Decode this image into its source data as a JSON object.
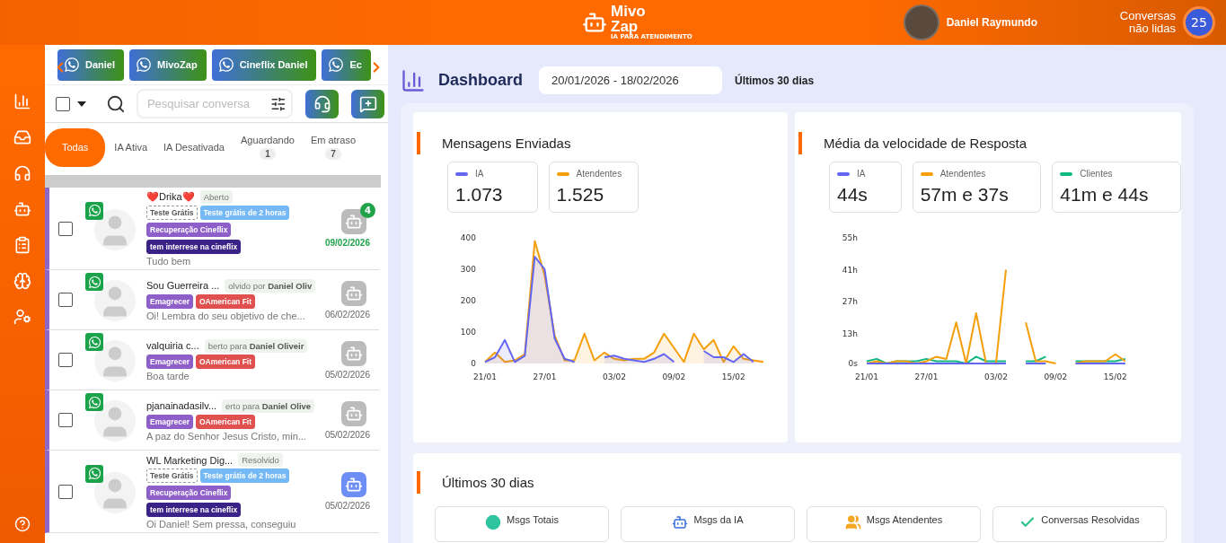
{
  "header": {
    "logo_name": "Mivo",
    "logo_name_2": "Zap",
    "logo_tagline": "IA PARA ATENDIMENTO",
    "user_name": "Daniel Raymundo",
    "unread_label": "Conversas não lidas",
    "unread_count": "25"
  },
  "accounts": [
    {
      "name": "Daniel"
    },
    {
      "name": "MivoZap"
    },
    {
      "name": "Cineflix Daniel"
    },
    {
      "name": "Ec"
    }
  ],
  "select_all": {
    "checked": false
  },
  "search": {
    "placeholder": "Pesquisar conversa"
  },
  "filters": [
    {
      "label": "Todas",
      "selected": true
    },
    {
      "label": "IA Ativa",
      "selected": false
    },
    {
      "label": "IA Desativada",
      "selected": false
    },
    {
      "label": "Aguardando",
      "count": "1",
      "selected": false
    },
    {
      "label": "Em atraso",
      "count": "7",
      "selected": false
    }
  ],
  "conversations": [
    {
      "name": "❤️Drika❤️",
      "status": "Aberto",
      "tags": [
        {
          "label": "Teste Grátis",
          "kind": "outline",
          "color": "#ffffff"
        },
        {
          "label": "Teste grátis de 2 horas",
          "kind": "fill",
          "color": "#74b9f5"
        },
        {
          "label": "Recuperação Cineflix",
          "kind": "fill",
          "color": "#8e5fc9"
        },
        {
          "label": "tem interrese na cineflix",
          "kind": "fill",
          "color": "#3b2286"
        }
      ],
      "preview": "Tudo bem",
      "date": "09/02/2026",
      "unread": "4",
      "ai_on": false,
      "checked": false
    },
    {
      "name": "Sou Guerreira ...",
      "status": "olvido por **Daniel Oliv**",
      "tags": [
        {
          "label": "Emagrecer",
          "kind": "fill",
          "color": "#8e5fc9"
        },
        {
          "label": "OAmerican Fit",
          "kind": "fill",
          "color": "#e0504f"
        }
      ],
      "preview": "Oi! Lembra do seu objetivo de che...",
      "date": "06/02/2026",
      "ai_on": false,
      "checked": false
    },
    {
      "name": "valquiria c...",
      "status": "berto para **Daniel Oliveir**",
      "tags": [
        {
          "label": "Emagrecer",
          "kind": "fill",
          "color": "#8e5fc9"
        },
        {
          "label": "OAmerican Fit",
          "kind": "fill",
          "color": "#e0504f"
        }
      ],
      "preview": "Boa tarde",
      "date": "05/02/2026",
      "ai_on": false,
      "checked": false
    },
    {
      "name": "pjanainadasilv...",
      "status": "erto para **Daniel Olive**",
      "tags": [
        {
          "label": "Emagrecer",
          "kind": "fill",
          "color": "#8e5fc9"
        },
        {
          "label": "OAmerican Fit",
          "kind": "fill",
          "color": "#e0504f"
        }
      ],
      "preview": "A paz do Senhor Jesus Cristo, min...",
      "date": "05/02/2026",
      "ai_on": false,
      "checked": false
    },
    {
      "name": "WL Marketing Dig...",
      "status": "Resolvido",
      "tags": [
        {
          "label": "Teste Grátis",
          "kind": "outline",
          "color": "#ffffff"
        },
        {
          "label": "Teste grátis de 2 horas",
          "kind": "fill",
          "color": "#74b9f5"
        },
        {
          "label": "Recuperação Cineflix",
          "kind": "fill",
          "color": "#8e5fc9"
        },
        {
          "label": "tem interrese na cineflix",
          "kind": "fill",
          "color": "#3b2286"
        }
      ],
      "preview": "Oi Daniel! Sem pressa, conseguiu",
      "date": "05/02/2026",
      "ai_on": true,
      "checked": false
    }
  ],
  "dashboard": {
    "title": "Dashboard",
    "date_range": "20/01/2026 - 18/02/2026",
    "period": "Últimos 30 dias",
    "cards": [
      {
        "title": "Mensagens Enviadas",
        "stats": [
          {
            "value": "1.073"
          },
          {
            "value": "1.525"
          }
        ],
        "chart_data": {
          "type": "area",
          "categories": [
            "21/01",
            null,
            null,
            null,
            null,
            null,
            "27/01",
            null,
            null,
            null,
            null,
            null,
            null,
            "03/02",
            null,
            null,
            null,
            null,
            null,
            "09/02",
            null,
            null,
            null,
            null,
            null,
            "15/02",
            null,
            null,
            null
          ],
          "ylim": [
            0,
            400
          ],
          "yticks": [
            0,
            100,
            200,
            300,
            400
          ],
          "series": [
            {
              "name": "IA",
              "color": "#6366f1",
              "values": [
                5,
                20,
                75,
                5,
                25,
                340,
                300,
                80,
                15,
                5,
                null,
                null,
                20,
                25,
                15,
                10,
                5,
                15,
                30,
                5,
                null,
                null,
                40,
                20,
                20,
                5,
                30,
                5,
                null
              ]
            },
            {
              "name": "Atendentes",
              "color": "#f59e0b",
              "values": [
                5,
                35,
                5,
                10,
                30,
                390,
                280,
                90,
                10,
                10,
                95,
                10,
                35,
                15,
                10,
                15,
                15,
                35,
                95,
                50,
                5,
                95,
                45,
                75,
                5,
                55,
                15,
                10,
                5
              ]
            }
          ]
        }
      },
      {
        "title": "Média da velocidade de Resposta",
        "stats": [
          {
            "value": "44s"
          },
          {
            "value": "57m e 37s"
          },
          {
            "value": "41m e 44s"
          }
        ],
        "chart_data": {
          "type": "line",
          "categories": [
            "21/01",
            null,
            null,
            null,
            null,
            null,
            "27/01",
            null,
            null,
            null,
            null,
            null,
            null,
            "03/02",
            null,
            null,
            null,
            null,
            null,
            "09/02",
            null,
            null,
            null,
            null,
            null,
            "15/02",
            null,
            null,
            null
          ],
          "ylim": [
            0,
            55
          ],
          "yticks": [
            {
              "value": 0,
              "label": "0s"
            },
            {
              "value": 13,
              "label": "13h"
            },
            {
              "value": 27,
              "label": "27h"
            },
            {
              "value": 41,
              "label": "41h"
            },
            {
              "value": 55,
              "label": "55h"
            }
          ],
          "series": [
            {
              "name": "IA",
              "color": "#6366f1",
              "values": [
                0,
                0,
                0,
                0,
                0,
                0,
                0,
                0,
                0,
                0,
                0,
                0,
                0,
                0,
                0,
                null,
                0,
                0,
                0,
                null,
                null,
                0,
                0,
                0,
                0,
                0,
                0,
                null,
                null
              ]
            },
            {
              "name": "Atendentes",
              "color": "#f59e0b",
              "values": [
                0,
                1,
                0,
                1,
                1,
                0,
                1,
                3,
                2,
                18,
                0,
                22,
                0,
                0,
                41,
                null,
                18,
                1,
                1,
                0,
                null,
                0,
                1,
                1,
                1,
                4,
                1,
                null,
                null
              ]
            },
            {
              "name": "Clientes",
              "color": "#10b981",
              "values": [
                1,
                2,
                0,
                1,
                1,
                1,
                2,
                1,
                1,
                1,
                0,
                3,
                1,
                1,
                1,
                null,
                1,
                1,
                3,
                null,
                null,
                1,
                1,
                1,
                1,
                1,
                2,
                null,
                null
              ]
            }
          ]
        }
      }
    ],
    "summary": {
      "title": "Últimos 30 dias",
      "items": [
        {
          "label": "Msgs Totais"
        },
        {
          "label": "Msgs da IA"
        },
        {
          "label": "Msgs Atendentes"
        },
        {
          "label": "Conversas Resolvidas"
        }
      ]
    }
  }
}
